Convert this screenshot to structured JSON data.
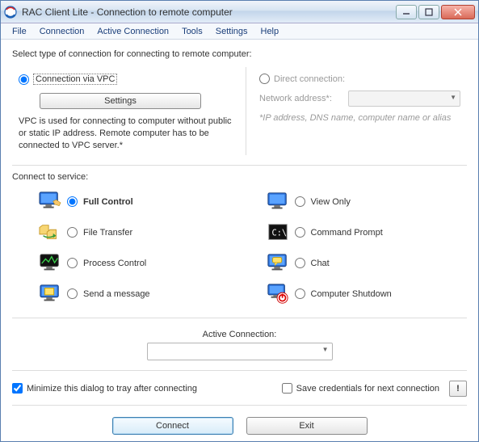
{
  "window": {
    "title": "RAC Client Lite - Connection to remote computer"
  },
  "menu": {
    "file": "File",
    "connection": "Connection",
    "active": "Active Connection",
    "tools": "Tools",
    "settings": "Settings",
    "help": "Help"
  },
  "instruction": "Select type of connection for connecting to remote computer:",
  "conn": {
    "vpc_label": "Connection via VPC",
    "settings_btn": "Settings",
    "vpc_desc": "VPC is used for connecting to computer without public or static IP address. Remote computer has to be connected to VPC server.*",
    "direct_label": "Direct connection:",
    "net_label": "Network address*:",
    "net_hint": "*IP address, DNS name, computer name or alias"
  },
  "services_label": "Connect to service:",
  "svc": {
    "full": "Full Control",
    "xfer": "File Transfer",
    "proc": "Process Control",
    "msg": "Send a message",
    "view": "View Only",
    "cmd": "Command Prompt",
    "chat": "Chat",
    "shut": "Computer Shutdown"
  },
  "active_label": "Active Connection:",
  "opts": {
    "minimize": "Minimize this dialog to tray after connecting",
    "save": "Save credentials for next connection",
    "excl": "!"
  },
  "buttons": {
    "connect": "Connect",
    "exit": "Exit"
  }
}
